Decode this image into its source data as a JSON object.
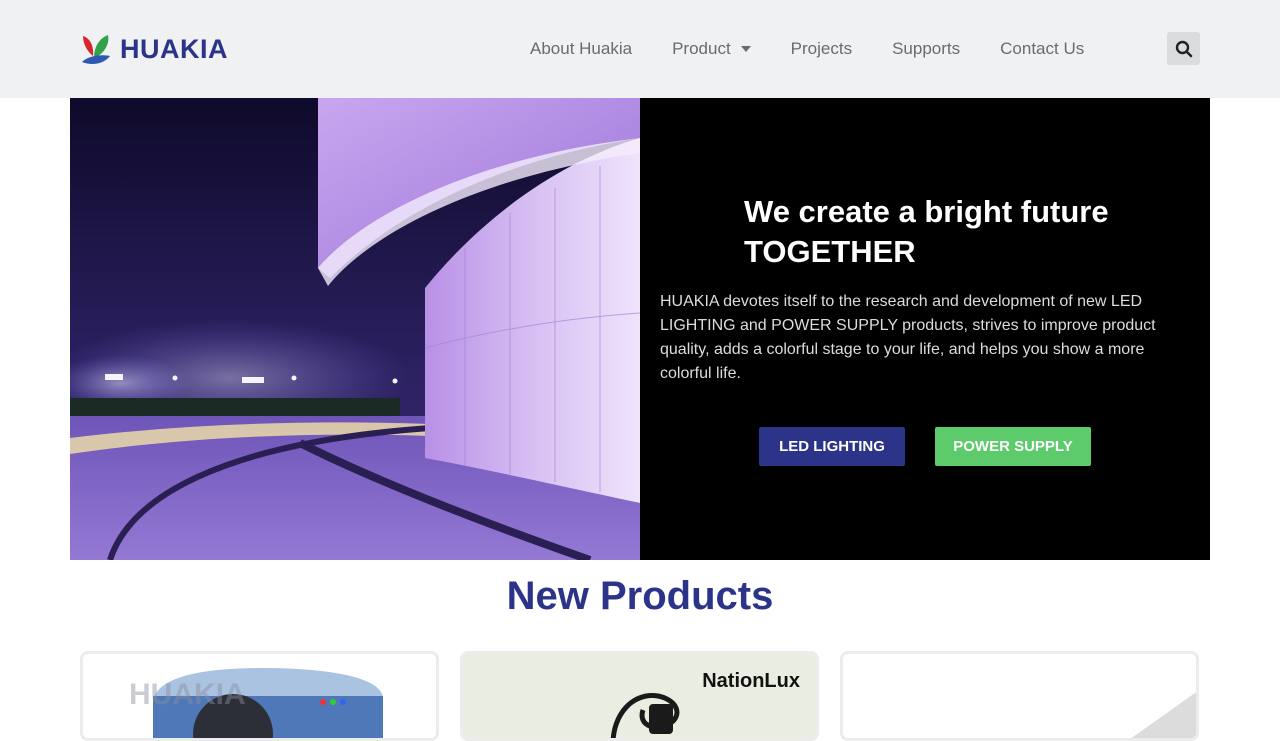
{
  "brand": {
    "name": "HUAKIA"
  },
  "nav": {
    "items": [
      {
        "label": "About Huakia"
      },
      {
        "label": "Product"
      },
      {
        "label": "Projects"
      },
      {
        "label": "Supports"
      },
      {
        "label": "Contact Us"
      }
    ]
  },
  "hero": {
    "title_line1": "We create a bright future",
    "title_line2": "TOGETHER",
    "description": "HUAKIA devotes itself to the research and development of new LED LIGHTING and POWER SUPPLY products, strives to improve product quality, adds a colorful stage to your life, and helps you show a more colorful life.",
    "buttons": {
      "led": "LED LIGHTING",
      "power": "POWER SUPPLY"
    }
  },
  "products": {
    "title": "New Products",
    "cards": [
      {
        "watermark": "HUAKIA"
      },
      {
        "brand": "NationLux"
      },
      {}
    ]
  },
  "colors": {
    "brand_blue": "#2c3489",
    "accent_green": "#5dcb6b",
    "header_bg": "#eff1f3"
  }
}
